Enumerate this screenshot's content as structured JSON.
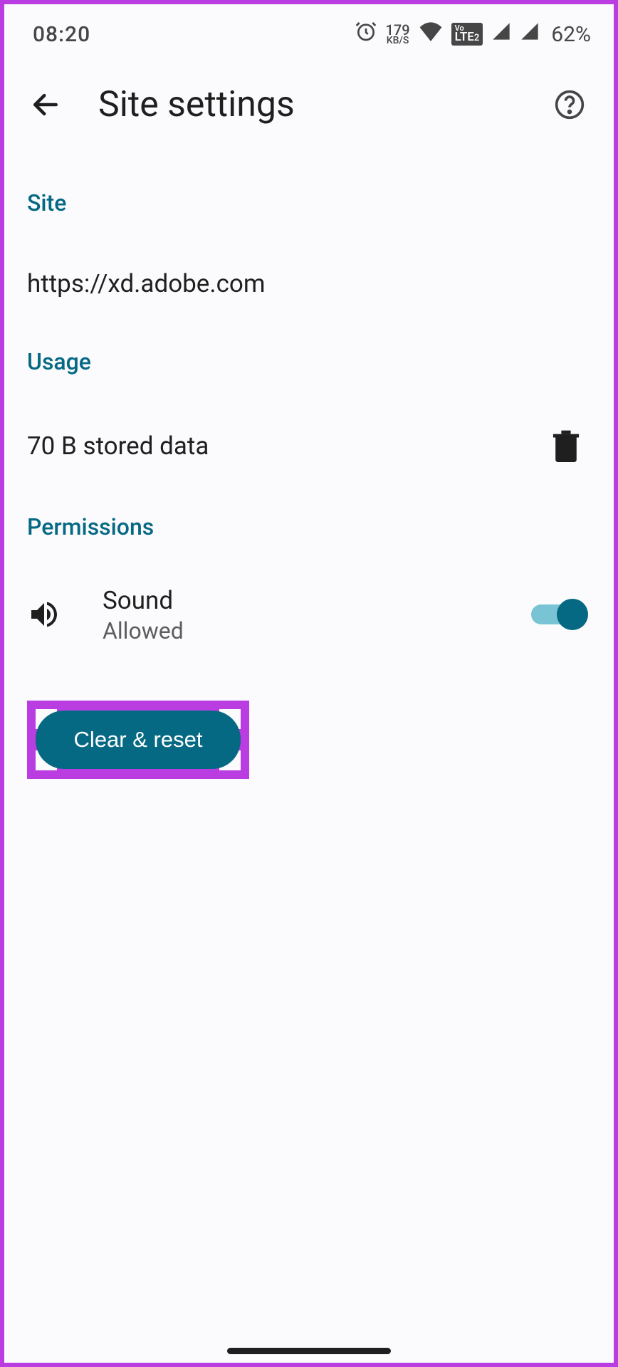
{
  "status_bar": {
    "time": "08:20",
    "speed_value": "179",
    "speed_unit": "KB/S",
    "volte": "VoLTE2",
    "battery": "62%"
  },
  "header": {
    "title": "Site settings"
  },
  "sections": {
    "site": {
      "label": "Site",
      "url": "https://xd.adobe.com"
    },
    "usage": {
      "label": "Usage",
      "stored_data": "70 B stored data"
    },
    "permissions": {
      "label": "Permissions",
      "sound": {
        "title": "Sound",
        "status": "Allowed",
        "enabled": true
      }
    }
  },
  "buttons": {
    "clear_reset": "Clear & reset"
  },
  "colors": {
    "accent_teal": "#066983",
    "highlight_purple": "#b93de0",
    "background": "#fbfbfd"
  }
}
